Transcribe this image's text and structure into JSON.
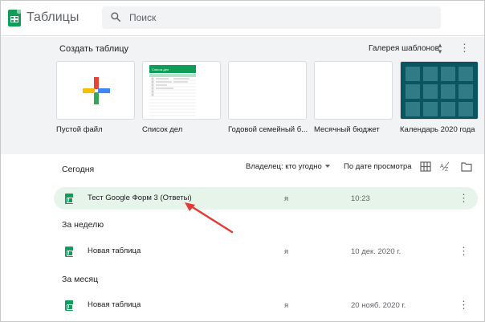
{
  "app": {
    "title": "Таблицы",
    "brand_color": "#0f9d58"
  },
  "search": {
    "placeholder": "Поиск",
    "value": ""
  },
  "gallery": {
    "title": "Создать таблицу",
    "link_label": "Галерея шаблонов",
    "toggle_icon": "unfold-icon",
    "menu_icon": "more-vert-icon",
    "templates": [
      {
        "label": "Пустой файл",
        "preview": "plus-icon"
      },
      {
        "label": "Список дел",
        "preview": "todo-list-preview"
      },
      {
        "label": "Годовой семейный б...",
        "preview": "blank-preview"
      },
      {
        "label": "Месячный бюджет",
        "preview": "blank-preview"
      },
      {
        "label": "Календарь 2020 года",
        "preview": "calendar-preview"
      }
    ],
    "todo_preview_title": "Список дел"
  },
  "recent": {
    "owner_filter": "Владелец: кто угодно",
    "sort_label": "По дате просмотра",
    "sections": [
      {
        "label": "Сегодня",
        "files": [
          {
            "name": "Тест Google Форм 3 (Ответы)",
            "owner": "я",
            "date": "10:23",
            "selected": true
          }
        ]
      },
      {
        "label": "За неделю",
        "files": [
          {
            "name": "Новая таблица",
            "owner": "я",
            "date": "10 дек. 2020 г.",
            "selected": false
          }
        ]
      },
      {
        "label": "За месяц",
        "files": [
          {
            "name": "Новая таблица",
            "owner": "я",
            "date": "20 нояб. 2020 г.",
            "selected": false
          }
        ]
      }
    ]
  },
  "annotation": {
    "color": "#e53935"
  }
}
